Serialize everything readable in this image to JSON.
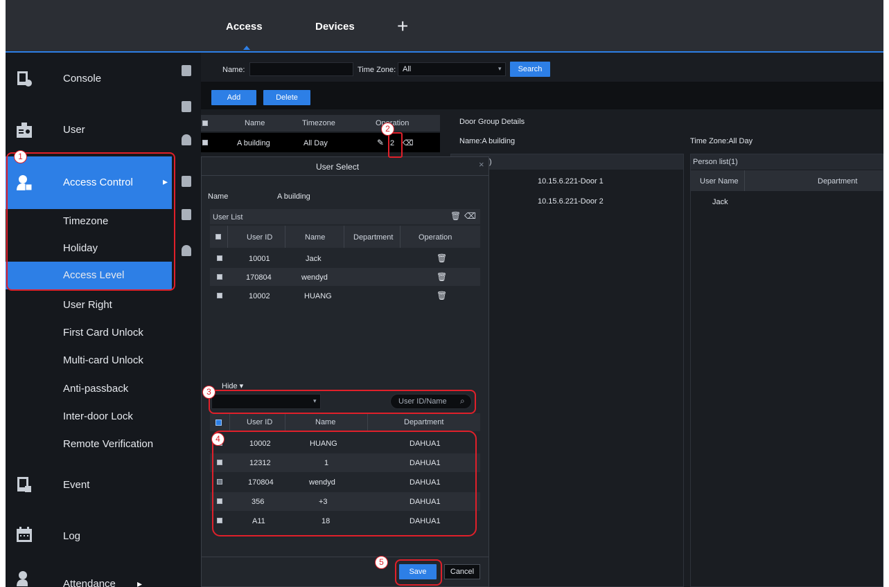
{
  "topbar": {
    "tabs": [
      "Access",
      "Devices"
    ],
    "add_tab": "+"
  },
  "sidebar": {
    "items": [
      {
        "label": "Console",
        "icon": "console-icon"
      },
      {
        "label": "User",
        "icon": "user-card-icon"
      },
      {
        "label": "Access Control",
        "icon": "access-control-icon"
      },
      {
        "label": "Event",
        "icon": "event-icon"
      },
      {
        "label": "Log",
        "icon": "calendar-icon"
      },
      {
        "label": "Attendance",
        "icon": "attendance-icon"
      }
    ],
    "sub_items": [
      "Timezone",
      "Holiday",
      "Access Level",
      "User Right",
      "First Card Unlock",
      "Multi-card Unlock",
      "Anti-passback",
      "Inter-door Lock",
      "Remote Verification"
    ],
    "arrow": "▸"
  },
  "filter": {
    "name_label": "Name:",
    "timezone_label": "Time Zone:",
    "timezone_value": "All",
    "search_label": "Search"
  },
  "actions": {
    "add": "Add",
    "delete": "Delete"
  },
  "group_table": {
    "headers": [
      "Name",
      "Timezone",
      "Operation"
    ],
    "row": {
      "name": "A building",
      "timezone": "All Day",
      "op_mid": "2"
    }
  },
  "details": {
    "title": "Door Group Details",
    "name_line": "Name:A building",
    "timezone_line": "Time Zone:All Day",
    "device_header": ")",
    "doors": [
      "10.15.6.221-Door 1",
      "10.15.6.221-Door 2"
    ],
    "person_header": "Person list(1)",
    "person_cols": [
      "User Name",
      "Department"
    ],
    "persons": [
      "Jack"
    ]
  },
  "modal": {
    "title": "User Select",
    "close": "×",
    "name_label": "Name",
    "name_value": "A building",
    "user_list_label": "User List",
    "list_headers": [
      "User ID",
      "Name",
      "Department",
      "Operation"
    ],
    "list_rows": [
      {
        "id": "10001",
        "name": "Jack",
        "dept": ""
      },
      {
        "id": "170804",
        "name": "wendyd",
        "dept": ""
      },
      {
        "id": "10002",
        "name": "HUANG",
        "dept": ""
      }
    ],
    "hide_label": "Hide",
    "search_placeholder": "User ID/Name",
    "pick_headers": [
      "User ID",
      "Name",
      "Department"
    ],
    "pick_rows": [
      {
        "id": "10002",
        "name": "HUANG",
        "dept": "DAHUA1"
      },
      {
        "id": "12312",
        "name": "1",
        "dept": "DAHUA1"
      },
      {
        "id": "170804",
        "name": "wendyd",
        "dept": "DAHUA1"
      },
      {
        "id": "356",
        "name": "+3",
        "dept": "DAHUA1"
      },
      {
        "id": "A11",
        "name": "18",
        "dept": "DAHUA1"
      }
    ],
    "save": "Save",
    "cancel": "Cancel"
  },
  "callouts": [
    "1",
    "2",
    "3",
    "4",
    "5"
  ],
  "colors": {
    "accent": "#2d7fe6",
    "callout": "#e0202a",
    "sidebar_bg": "#15181d"
  }
}
